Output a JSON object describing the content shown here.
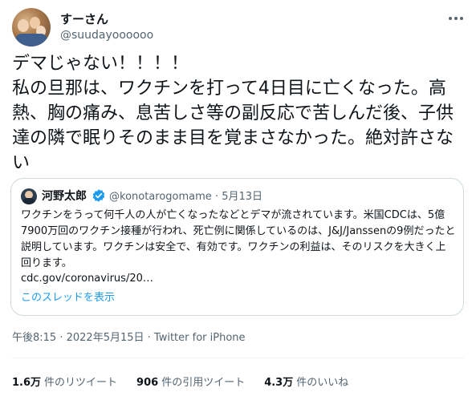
{
  "author": {
    "display_name": "すーさん",
    "handle": "@suudayoooooo"
  },
  "tweet": {
    "text": "デマじゃない！！！！\n私の旦那は、ワクチンを打って4日目に亡くなった。高熱、胸の痛み、息苦しさ等の副反応で苦しんだ後、子供達の隣で眠りそのまま目を覚まさなかった。絶対許さない"
  },
  "quoted": {
    "display_name": "河野太郎",
    "handle": "@konotarogomame",
    "separator": "·",
    "date": "5月13日",
    "text": "ワクチンをうって何千人の人が亡くなったなどとデマが流されています。米国CDCは、5億7900万回のワクチン接種が行われ、死亡例に関係しているのは、J&J/Janssenの9例だったと説明しています。ワクチンは安全で、有効です。ワクチンの利益は、そのリスクを大きく上回ります。",
    "link": "cdc.gov/coronavirus/20…",
    "show_thread": "このスレッドを表示"
  },
  "meta": {
    "time": "午後8:15",
    "date": "2022年5月15日",
    "source": "Twitter for iPhone"
  },
  "stats": {
    "retweets_count": "1.6万",
    "retweets_label": "件のリツイート",
    "quotes_count": "906",
    "quotes_label": "件の引用ツイート",
    "likes_count": "4.3万",
    "likes_label": "件のいいね"
  },
  "colors": {
    "accent": "#1d9bf0",
    "secondary_text": "#536471",
    "border": "#cfd9de"
  },
  "icons": [
    "avatar",
    "more-icon",
    "verified-icon"
  ]
}
